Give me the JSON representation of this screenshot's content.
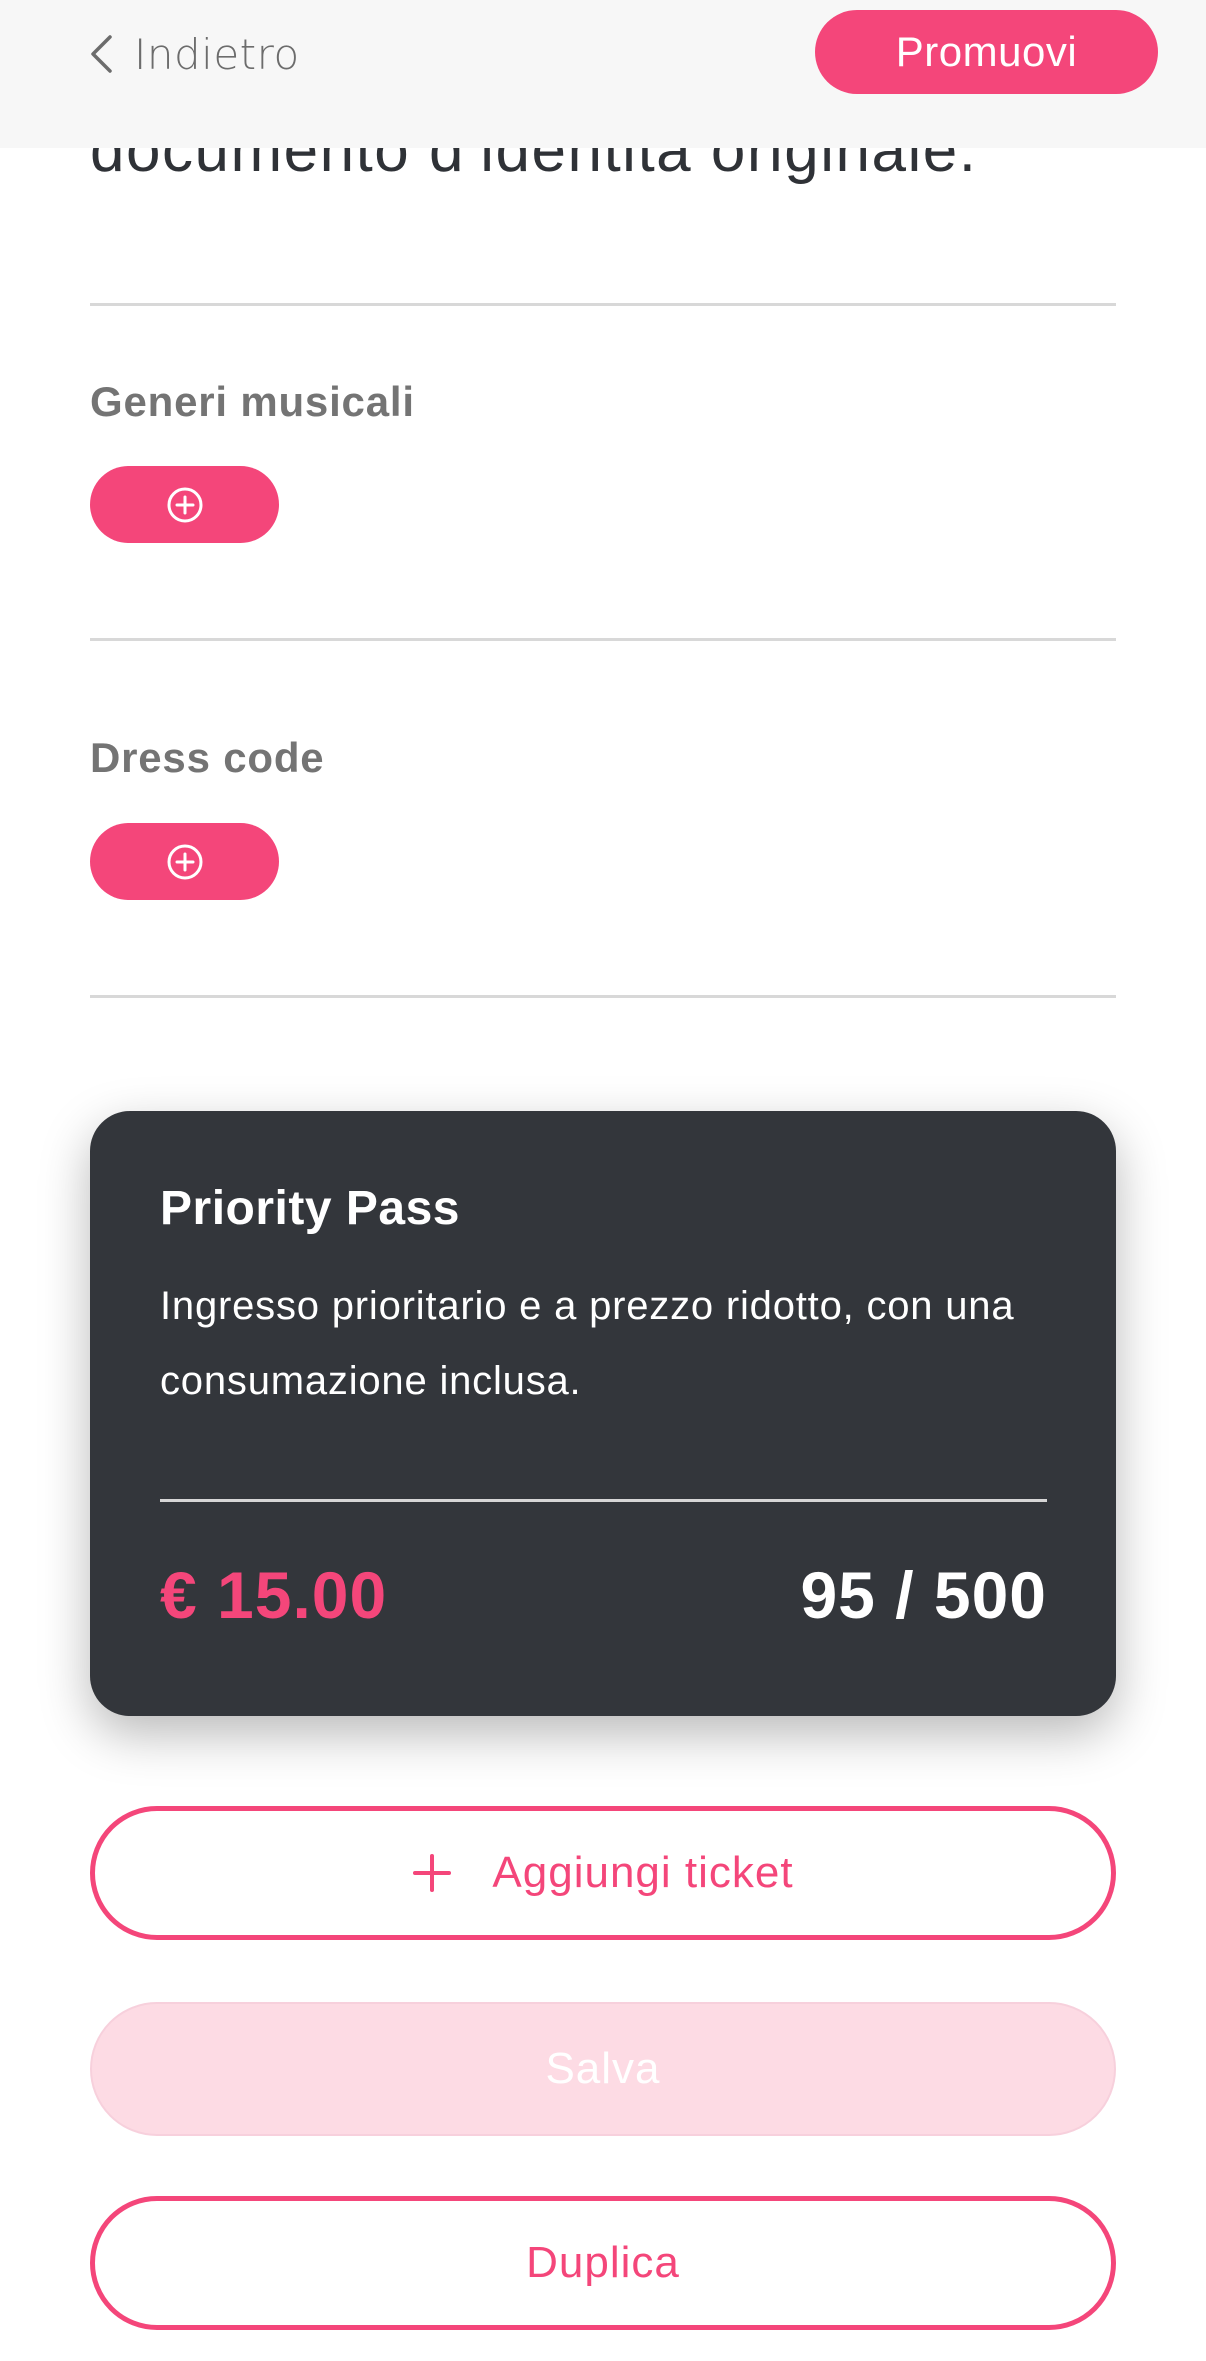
{
  "header": {
    "back_label": "Indietro",
    "promote_label": "Promuovi"
  },
  "headline": "documento d’identità originale.",
  "sections": {
    "genres": {
      "title": "Generi musicali"
    },
    "dress_code": {
      "title": "Dress code"
    }
  },
  "ticket": {
    "name": "Priority Pass",
    "description": "Ingresso prioritario e a prezzo ridotto, con una consumazione inclusa.",
    "price": "€ 15.00",
    "availability": "95 / 500"
  },
  "actions": {
    "add_ticket_label": "Aggiungi ticket",
    "save_label": "Salva",
    "duplicate_label": "Duplica"
  },
  "colors": {
    "accent": "#f4467a",
    "card_bg": "#33363b",
    "disabled_bg": "#fddbe4"
  },
  "icons": {
    "back": "chevron-left-icon",
    "add_circle": "plus-circle-icon",
    "add": "plus-icon"
  }
}
